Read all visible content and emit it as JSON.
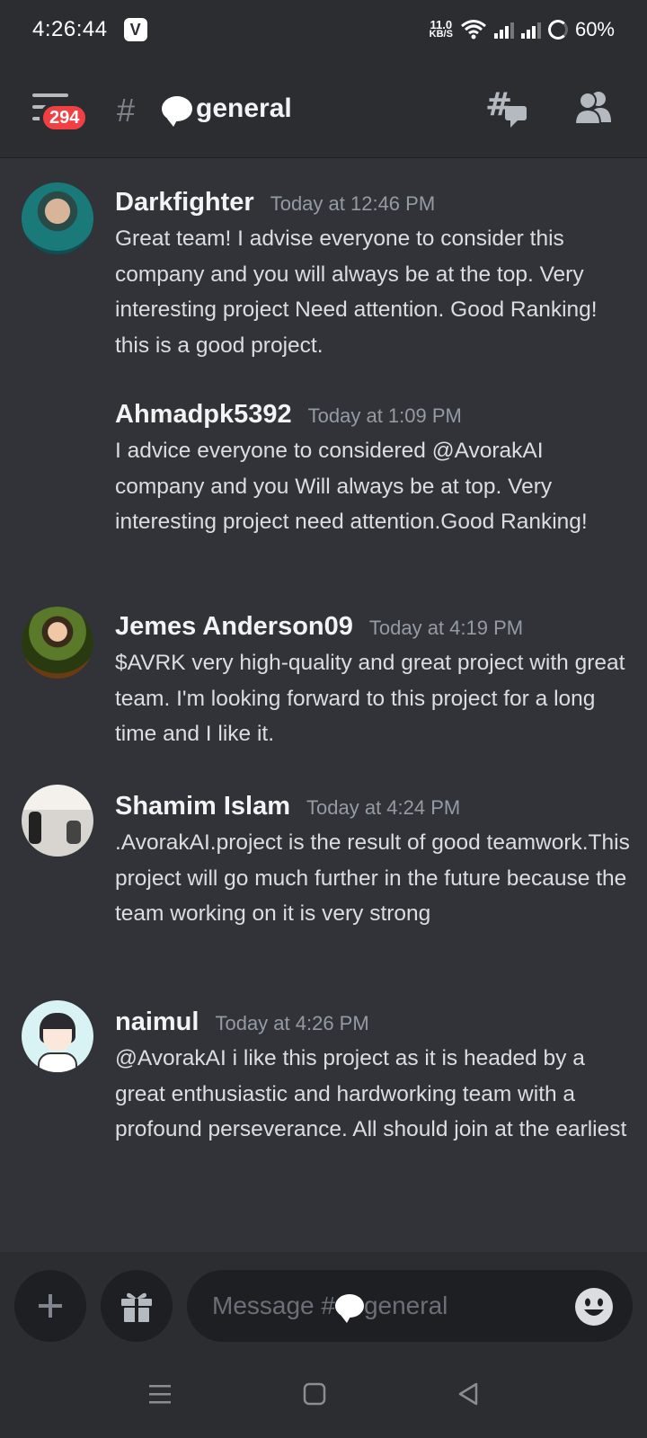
{
  "status_bar": {
    "time": "4:26:44",
    "app_badge": "V",
    "net_speed_value": "11.0",
    "net_speed_unit": "KB/S",
    "battery": "60%"
  },
  "header": {
    "unread_count": "294",
    "channel_name": "general"
  },
  "messages": [
    {
      "author": "Darkfighter",
      "time": "Today at 12:46 PM",
      "text": "Great team! I advise everyone to consider this company and you will always be at the top. Very interesting project Need attention. Good Ranking! this is a good project."
    },
    {
      "author": "Ahmadpk5392",
      "time": "Today at 1:09 PM",
      "text": "I advice everyone to considered @AvorakAI company and you Will always be at top. Very interesting project need attention.Good Ranking!"
    },
    {
      "author": "Jemes Anderson09",
      "time": "Today at 4:19 PM",
      "text": "$AVRK very high-quality and great project with great team. I'm looking forward to this project for a long time and I like it."
    },
    {
      "author": "Shamim Islam",
      "time": "Today at 4:24 PM",
      "text": ".AvorakAI.project is the result of good teamwork.This project will go much further in the future because the team working on it is very strong"
    },
    {
      "author": "naimul",
      "time": "Today at 4:26 PM",
      "text": "@AvorakAI i like this project as it is headed by a great enthusiastic and hardworking team with a profound perseverance. All should join at the earliest"
    }
  ],
  "composer": {
    "placeholder_prefix": "Message #",
    "placeholder_channel": "general"
  },
  "colors": {
    "background": "#313338",
    "header": "#2b2d31",
    "badge": "#f23f43"
  }
}
